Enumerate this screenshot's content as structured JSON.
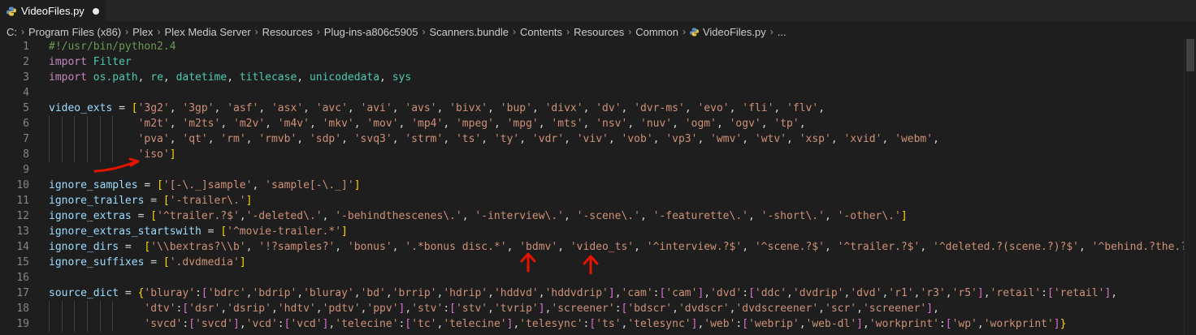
{
  "tab": {
    "filename": "VideoFiles.py",
    "modified_indicator": "●"
  },
  "breadcrumb": [
    "C:",
    "Program Files (x86)",
    "Plex",
    "Plex Media Server",
    "Resources",
    "Plug-ins-a806c5905",
    "Scanners.bundle",
    "Contents",
    "Resources",
    "Common",
    "VideoFiles.py",
    "..."
  ],
  "colors": {
    "keyword": "#c586c0",
    "module": "#4ec9b0",
    "string": "#ce9178",
    "variable": "#9cdcfe",
    "comment": "#6a9955",
    "bracket_level1": "#ffd700",
    "bracket_level2": "#da70d6",
    "bracket_level3": "#179fff",
    "annotation": "#e51400",
    "background": "#1e1e1e"
  },
  "annotations": [
    {
      "kind": "underline-arrow",
      "line": 8,
      "icon": "red-curved-arrow"
    },
    {
      "kind": "up-arrow",
      "line": 14,
      "target": "bdmv",
      "icon": "red-up-arrow"
    },
    {
      "kind": "up-arrow",
      "line": 14,
      "target": "video_ts",
      "icon": "red-up-arrow"
    }
  ],
  "lines": [
    {
      "n": "1",
      "tokens": [
        [
          "cmt",
          "#!/usr/bin/python2.4"
        ]
      ]
    },
    {
      "n": "2",
      "tokens": [
        [
          "kw",
          "import"
        ],
        [
          "",
          " "
        ],
        [
          "mod",
          "Filter"
        ]
      ]
    },
    {
      "n": "3",
      "tokens": [
        [
          "kw",
          "import"
        ],
        [
          "",
          " "
        ],
        [
          "mod",
          "os.path"
        ],
        [
          "",
          ", "
        ],
        [
          "mod",
          "re"
        ],
        [
          "",
          ", "
        ],
        [
          "mod",
          "datetime"
        ],
        [
          "",
          ", "
        ],
        [
          "mod",
          "titlecase"
        ],
        [
          "",
          ", "
        ],
        [
          "mod",
          "unicodedata"
        ],
        [
          "",
          ", "
        ],
        [
          "mod",
          "sys"
        ]
      ]
    },
    {
      "n": "4",
      "tokens": []
    },
    {
      "n": "5",
      "tokens": [
        [
          "var",
          "video_exts"
        ],
        [
          "",
          " = "
        ],
        [
          "br1",
          "["
        ],
        [
          "str",
          "'3g2'"
        ],
        [
          "",
          ", "
        ],
        [
          "str",
          "'3gp'"
        ],
        [
          "",
          ", "
        ],
        [
          "str",
          "'asf'"
        ],
        [
          "",
          ", "
        ],
        [
          "str",
          "'asx'"
        ],
        [
          "",
          ", "
        ],
        [
          "str",
          "'avc'"
        ],
        [
          "",
          ", "
        ],
        [
          "str",
          "'avi'"
        ],
        [
          "",
          ", "
        ],
        [
          "str",
          "'avs'"
        ],
        [
          "",
          ", "
        ],
        [
          "str",
          "'bivx'"
        ],
        [
          "",
          ", "
        ],
        [
          "str",
          "'bup'"
        ],
        [
          "",
          ", "
        ],
        [
          "str",
          "'divx'"
        ],
        [
          "",
          ", "
        ],
        [
          "str",
          "'dv'"
        ],
        [
          "",
          ", "
        ],
        [
          "str",
          "'dvr-ms'"
        ],
        [
          "",
          ", "
        ],
        [
          "str",
          "'evo'"
        ],
        [
          "",
          ", "
        ],
        [
          "str",
          "'fli'"
        ],
        [
          "",
          ", "
        ],
        [
          "str",
          "'flv'"
        ],
        [
          "",
          ","
        ]
      ]
    },
    {
      "n": "6",
      "indent": 6,
      "tokens": [
        [
          "",
          "              "
        ],
        [
          "str",
          "'m2t'"
        ],
        [
          "",
          ", "
        ],
        [
          "str",
          "'m2ts'"
        ],
        [
          "",
          ", "
        ],
        [
          "str",
          "'m2v'"
        ],
        [
          "",
          ", "
        ],
        [
          "str",
          "'m4v'"
        ],
        [
          "",
          ", "
        ],
        [
          "str",
          "'mkv'"
        ],
        [
          "",
          ", "
        ],
        [
          "str",
          "'mov'"
        ],
        [
          "",
          ", "
        ],
        [
          "str",
          "'mp4'"
        ],
        [
          "",
          ", "
        ],
        [
          "str",
          "'mpeg'"
        ],
        [
          "",
          ", "
        ],
        [
          "str",
          "'mpg'"
        ],
        [
          "",
          ", "
        ],
        [
          "str",
          "'mts'"
        ],
        [
          "",
          ", "
        ],
        [
          "str",
          "'nsv'"
        ],
        [
          "",
          ", "
        ],
        [
          "str",
          "'nuv'"
        ],
        [
          "",
          ", "
        ],
        [
          "str",
          "'ogm'"
        ],
        [
          "",
          ", "
        ],
        [
          "str",
          "'ogv'"
        ],
        [
          "",
          ", "
        ],
        [
          "str",
          "'tp'"
        ],
        [
          "",
          ","
        ]
      ]
    },
    {
      "n": "7",
      "indent": 6,
      "tokens": [
        [
          "",
          "              "
        ],
        [
          "str",
          "'pva'"
        ],
        [
          "",
          ", "
        ],
        [
          "str",
          "'qt'"
        ],
        [
          "",
          ", "
        ],
        [
          "str",
          "'rm'"
        ],
        [
          "",
          ", "
        ],
        [
          "str",
          "'rmvb'"
        ],
        [
          "",
          ", "
        ],
        [
          "str",
          "'sdp'"
        ],
        [
          "",
          ", "
        ],
        [
          "str",
          "'svq3'"
        ],
        [
          "",
          ", "
        ],
        [
          "str",
          "'strm'"
        ],
        [
          "",
          ", "
        ],
        [
          "str",
          "'ts'"
        ],
        [
          "",
          ", "
        ],
        [
          "str",
          "'ty'"
        ],
        [
          "",
          ", "
        ],
        [
          "str",
          "'vdr'"
        ],
        [
          "",
          ", "
        ],
        [
          "str",
          "'viv'"
        ],
        [
          "",
          ", "
        ],
        [
          "str",
          "'vob'"
        ],
        [
          "",
          ", "
        ],
        [
          "str",
          "'vp3'"
        ],
        [
          "",
          ", "
        ],
        [
          "str",
          "'wmv'"
        ],
        [
          "",
          ", "
        ],
        [
          "str",
          "'wtv'"
        ],
        [
          "",
          ", "
        ],
        [
          "str",
          "'xsp'"
        ],
        [
          "",
          ", "
        ],
        [
          "str",
          "'xvid'"
        ],
        [
          "",
          ", "
        ],
        [
          "str",
          "'webm'"
        ],
        [
          "",
          ","
        ]
      ]
    },
    {
      "n": "8",
      "indent": 6,
      "tokens": [
        [
          "",
          "              "
        ],
        [
          "str",
          "'iso'"
        ],
        [
          "br1",
          "]"
        ]
      ]
    },
    {
      "n": "9",
      "tokens": []
    },
    {
      "n": "10",
      "tokens": [
        [
          "var",
          "ignore_samples"
        ],
        [
          "",
          " = "
        ],
        [
          "br1",
          "["
        ],
        [
          "str",
          "'[-\\._]sample'"
        ],
        [
          "",
          ", "
        ],
        [
          "str",
          "'sample[-\\._]'"
        ],
        [
          "br1",
          "]"
        ]
      ]
    },
    {
      "n": "11",
      "tokens": [
        [
          "var",
          "ignore_trailers"
        ],
        [
          "",
          " = "
        ],
        [
          "br1",
          "["
        ],
        [
          "str",
          "'-trailer\\.'"
        ],
        [
          "br1",
          "]"
        ]
      ]
    },
    {
      "n": "12",
      "tokens": [
        [
          "var",
          "ignore_extras"
        ],
        [
          "",
          " = "
        ],
        [
          "br1",
          "["
        ],
        [
          "str",
          "'^trailer.?$'"
        ],
        [
          "",
          ","
        ],
        [
          "str",
          "'-deleted\\.'"
        ],
        [
          "",
          ", "
        ],
        [
          "str",
          "'-behindthescenes\\.'"
        ],
        [
          "",
          ", "
        ],
        [
          "str",
          "'-interview\\.'"
        ],
        [
          "",
          ", "
        ],
        [
          "str",
          "'-scene\\.'"
        ],
        [
          "",
          ", "
        ],
        [
          "str",
          "'-featurette\\.'"
        ],
        [
          "",
          ", "
        ],
        [
          "str",
          "'-short\\.'"
        ],
        [
          "",
          ", "
        ],
        [
          "str",
          "'-other\\.'"
        ],
        [
          "br1",
          "]"
        ]
      ]
    },
    {
      "n": "13",
      "tokens": [
        [
          "var",
          "ignore_extras_startswith"
        ],
        [
          "",
          " = "
        ],
        [
          "br1",
          "["
        ],
        [
          "str",
          "'^movie-trailer.*'"
        ],
        [
          "br1",
          "]"
        ]
      ]
    },
    {
      "n": "14",
      "tokens": [
        [
          "var",
          "ignore_dirs"
        ],
        [
          "",
          " =  "
        ],
        [
          "br1",
          "["
        ],
        [
          "str",
          "'\\\\bextras?\\\\b'"
        ],
        [
          "",
          ", "
        ],
        [
          "str",
          "'!?samples?'"
        ],
        [
          "",
          ", "
        ],
        [
          "str",
          "'bonus'"
        ],
        [
          "",
          ", "
        ],
        [
          "str",
          "'.*bonus disc.*'"
        ],
        [
          "",
          ", "
        ],
        [
          "str",
          "'bdmv'"
        ],
        [
          "",
          ", "
        ],
        [
          "str",
          "'video_ts'"
        ],
        [
          "",
          ", "
        ],
        [
          "str",
          "'^interview.?$'"
        ],
        [
          "",
          ", "
        ],
        [
          "str",
          "'^scene.?$'"
        ],
        [
          "",
          ", "
        ],
        [
          "str",
          "'^trailer.?$'"
        ],
        [
          "",
          ", "
        ],
        [
          "str",
          "'^deleted.?(scene.?)?$'"
        ],
        [
          "",
          ", "
        ],
        [
          "str",
          "'^behind.?the.?scenes$'"
        ]
      ]
    },
    {
      "n": "15",
      "tokens": [
        [
          "var",
          "ignore_suffixes"
        ],
        [
          "",
          " = "
        ],
        [
          "br1",
          "["
        ],
        [
          "str",
          "'.dvdmedia'"
        ],
        [
          "br1",
          "]"
        ]
      ]
    },
    {
      "n": "16",
      "tokens": []
    },
    {
      "n": "17",
      "tokens": [
        [
          "var",
          "source_dict"
        ],
        [
          "",
          " = "
        ],
        [
          "br1",
          "{"
        ],
        [
          "str",
          "'bluray'"
        ],
        [
          "",
          ":"
        ],
        [
          "br2",
          "["
        ],
        [
          "str",
          "'bdrc'"
        ],
        [
          "",
          ","
        ],
        [
          "str",
          "'bdrip'"
        ],
        [
          "",
          ","
        ],
        [
          "str",
          "'bluray'"
        ],
        [
          "",
          ","
        ],
        [
          "str",
          "'bd'"
        ],
        [
          "",
          ","
        ],
        [
          "str",
          "'brrip'"
        ],
        [
          "",
          ","
        ],
        [
          "str",
          "'hdrip'"
        ],
        [
          "",
          ","
        ],
        [
          "str",
          "'hddvd'"
        ],
        [
          "",
          ","
        ],
        [
          "str",
          "'hddvdrip'"
        ],
        [
          "br2",
          "]"
        ],
        [
          "",
          ","
        ],
        [
          "str",
          "'cam'"
        ],
        [
          "",
          ":"
        ],
        [
          "br2",
          "["
        ],
        [
          "str",
          "'cam'"
        ],
        [
          "br2",
          "]"
        ],
        [
          "",
          ","
        ],
        [
          "str",
          "'dvd'"
        ],
        [
          "",
          ":"
        ],
        [
          "br2",
          "["
        ],
        [
          "str",
          "'ddc'"
        ],
        [
          "",
          ","
        ],
        [
          "str",
          "'dvdrip'"
        ],
        [
          "",
          ","
        ],
        [
          "str",
          "'dvd'"
        ],
        [
          "",
          ","
        ],
        [
          "str",
          "'r1'"
        ],
        [
          "",
          ","
        ],
        [
          "str",
          "'r3'"
        ],
        [
          "",
          ","
        ],
        [
          "str",
          "'r5'"
        ],
        [
          "br2",
          "]"
        ],
        [
          "",
          ","
        ],
        [
          "str",
          "'retail'"
        ],
        [
          "",
          ":"
        ],
        [
          "br2",
          "["
        ],
        [
          "str",
          "'retail'"
        ],
        [
          "br2",
          "]"
        ],
        [
          "",
          ","
        ]
      ]
    },
    {
      "n": "18",
      "indent": 6,
      "tokens": [
        [
          "",
          "               "
        ],
        [
          "str",
          "'dtv'"
        ],
        [
          "",
          ":"
        ],
        [
          "br2",
          "["
        ],
        [
          "str",
          "'dsr'"
        ],
        [
          "",
          ","
        ],
        [
          "str",
          "'dsrip'"
        ],
        [
          "",
          ","
        ],
        [
          "str",
          "'hdtv'"
        ],
        [
          "",
          ","
        ],
        [
          "str",
          "'pdtv'"
        ],
        [
          "",
          ","
        ],
        [
          "str",
          "'ppv'"
        ],
        [
          "br2",
          "]"
        ],
        [
          "",
          ","
        ],
        [
          "str",
          "'stv'"
        ],
        [
          "",
          ":"
        ],
        [
          "br2",
          "["
        ],
        [
          "str",
          "'stv'"
        ],
        [
          "",
          ","
        ],
        [
          "str",
          "'tvrip'"
        ],
        [
          "br2",
          "]"
        ],
        [
          "",
          ","
        ],
        [
          "str",
          "'screener'"
        ],
        [
          "",
          ":"
        ],
        [
          "br2",
          "["
        ],
        [
          "str",
          "'bdscr'"
        ],
        [
          "",
          ","
        ],
        [
          "str",
          "'dvdscr'"
        ],
        [
          "",
          ","
        ],
        [
          "str",
          "'dvdscreener'"
        ],
        [
          "",
          ","
        ],
        [
          "str",
          "'scr'"
        ],
        [
          "",
          ","
        ],
        [
          "str",
          "'screener'"
        ],
        [
          "br2",
          "]"
        ],
        [
          "",
          ","
        ]
      ]
    },
    {
      "n": "19",
      "indent": 6,
      "tokens": [
        [
          "",
          "               "
        ],
        [
          "str",
          "'svcd'"
        ],
        [
          "",
          ":"
        ],
        [
          "br2",
          "["
        ],
        [
          "str",
          "'svcd'"
        ],
        [
          "br2",
          "]"
        ],
        [
          "",
          ","
        ],
        [
          "str",
          "'vcd'"
        ],
        [
          "",
          ":"
        ],
        [
          "br2",
          "["
        ],
        [
          "str",
          "'vcd'"
        ],
        [
          "br2",
          "]"
        ],
        [
          "",
          ","
        ],
        [
          "str",
          "'telecine'"
        ],
        [
          "",
          ":"
        ],
        [
          "br2",
          "["
        ],
        [
          "str",
          "'tc'"
        ],
        [
          "",
          ","
        ],
        [
          "str",
          "'telecine'"
        ],
        [
          "br2",
          "]"
        ],
        [
          "",
          ","
        ],
        [
          "str",
          "'telesync'"
        ],
        [
          "",
          ":"
        ],
        [
          "br2",
          "["
        ],
        [
          "str",
          "'ts'"
        ],
        [
          "",
          ","
        ],
        [
          "str",
          "'telesync'"
        ],
        [
          "br2",
          "]"
        ],
        [
          "",
          ","
        ],
        [
          "str",
          "'web'"
        ],
        [
          "",
          ":"
        ],
        [
          "br2",
          "["
        ],
        [
          "str",
          "'webrip'"
        ],
        [
          "",
          ","
        ],
        [
          "str",
          "'web-dl'"
        ],
        [
          "br2",
          "]"
        ],
        [
          "",
          ","
        ],
        [
          "str",
          "'workprint'"
        ],
        [
          "",
          ":"
        ],
        [
          "br2",
          "["
        ],
        [
          "str",
          "'wp'"
        ],
        [
          "",
          ","
        ],
        [
          "str",
          "'workprint'"
        ],
        [
          "br2",
          "]"
        ],
        [
          "br1",
          "}"
        ]
      ]
    }
  ]
}
